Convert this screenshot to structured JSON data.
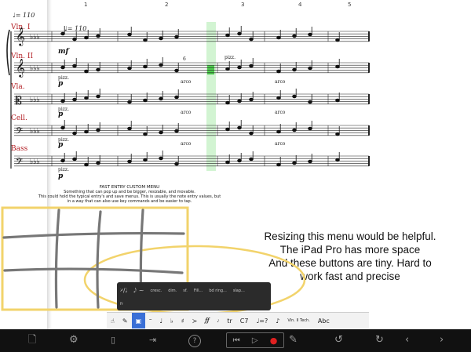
{
  "score": {
    "tempo_top": "♩= 110",
    "tempo_staff": "♩= 110",
    "measure_numbers": [
      "1",
      "2",
      "3",
      "4",
      "5"
    ],
    "instruments": [
      "Vln. I",
      "Vln. II",
      "Vla.",
      "Cell.",
      "Bass"
    ],
    "dynamics": {
      "vln1": "mf",
      "vln2": "p",
      "vla": "p",
      "cell": "p",
      "bass": "p"
    },
    "markings": {
      "pizz": "pizz.",
      "arco": "arco",
      "tuplet": "6"
    }
  },
  "fast_entry_note": {
    "title": "FAST ENTRY CUSTOM MENU",
    "line1": "Something that can pop up and be bigger, resizable, and movable.",
    "line2": "This could hold the typical entry's and save menus. This is usually the note entry values, but",
    "line3": "in a way that can also use key commands and be easier to tap."
  },
  "annotation": {
    "line1": "Resizing this menu would be helpful.",
    "line2": "The iPad Pro has more space",
    "line3": "And these buttons are tiny. Hard to",
    "line4": "work fast and precise"
  },
  "fast_entry_menu": {
    "row1": [
      "𝄎/𝅗𝅥",
      "𝅘𝅥𝅮 ~",
      "cresc.",
      "dim.",
      "sf.",
      "Fill...",
      "bd ring...",
      "slap..."
    ],
    "row2": [
      "fr",
      "",
      "",
      "",
      "",
      "",
      "",
      ""
    ]
  },
  "entry_toolbar": {
    "items": [
      "☝",
      "✎",
      "▣",
      "𝄼",
      "♩",
      "♭",
      "♯",
      "≻",
      "𝆑𝆑",
      "𝆕",
      "tr",
      "C7",
      "♩=?",
      "♪",
      "Vln. II Tech.",
      "Abc"
    ]
  },
  "bottom_bar": {
    "document_icon": "document-icon",
    "settings_icon": "gear-icon",
    "help_label": "?",
    "undo_icon": "undo-icon",
    "redo_icon": "redo-icon"
  },
  "colors": {
    "instrument_label": "#b21e23",
    "playhead_highlight": "#7fe07f",
    "annotation_marker": "#f2d36b",
    "selection": "#3a6fd6",
    "record": "#e02020"
  }
}
